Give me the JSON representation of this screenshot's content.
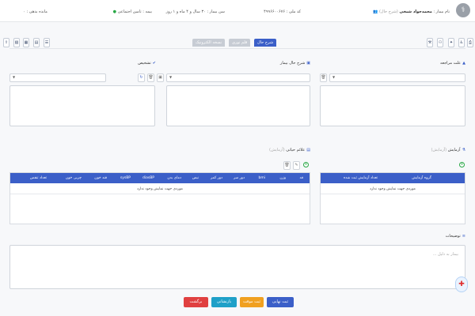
{
  "header": {
    "patient_label": "نام بیمار :",
    "patient_name": "محمدجواد شیخی",
    "history_link": "(شرح حال)",
    "code_label": "کد ملی :",
    "code_value": "۴۹۹۶۶۰۰۶۷۶",
    "age_label": "سن بیمار :",
    "age_value": "۳۰ سال و ۴ ماه و ۱ روز",
    "insurance_label": "بیمه :",
    "insurance_value": "تامین اجتماعی",
    "balance_label": "مانده بدهی :",
    "balance_value": "۰"
  },
  "tabs": [
    {
      "label": "شرح حال"
    },
    {
      "label": "قلم نوری"
    },
    {
      "label": "نسخه الکترونیک"
    }
  ],
  "sections": {
    "reason": {
      "title": "علت مراجعه"
    },
    "history": {
      "title": "شرح حال بیمار"
    },
    "diagnosis": {
      "title": "تشخیص"
    },
    "tests": {
      "title": "آزمایش",
      "hint": "(آزمایش)"
    },
    "vitals": {
      "title": "علائم حیاتی",
      "hint": "(آزمایش)"
    },
    "notes": {
      "title": "توضیحات",
      "placeholder": "بیمار به دلیل ..."
    }
  },
  "tests_table": {
    "columns": [
      "گروه آزمایش",
      "تعداد آزمایش ثبت شده"
    ],
    "empty": "موردی جهت نمایش وجود ندارد"
  },
  "vitals_table": {
    "columns": [
      "قد",
      "وزن",
      "bmi",
      "دور سر",
      "دور کمر",
      "نبض",
      "دمای بدن",
      "diasBP",
      "sysBP",
      "قند خون",
      "چربی خون",
      "تعداد تنفس"
    ],
    "empty": "موردی جهت نمایش وجود ندارد"
  },
  "buttons": {
    "final": "ثبت نهایی",
    "temp": "ثبت موقت",
    "review": "بازنشانی",
    "back": "برگشت"
  },
  "colors": {
    "primary": "#3b5fc8",
    "warning": "#f0a020",
    "info": "#1fa0c8",
    "danger": "#e04040"
  }
}
